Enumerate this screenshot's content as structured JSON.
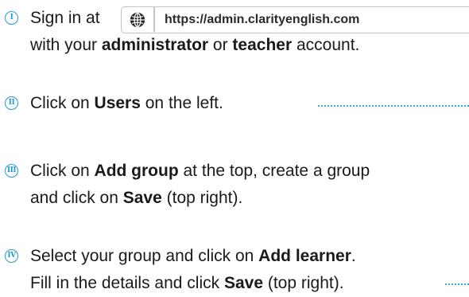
{
  "steps": [
    {
      "numeral": "I",
      "lines": [
        {
          "parts": [
            "Sign in at"
          ]
        },
        {
          "parts": [
            "with your ",
            "administrator",
            " or ",
            "teacher",
            " account."
          ]
        }
      ],
      "url": "https://admin.clarityenglish.com",
      "url_icon": "globe-icon"
    },
    {
      "numeral": "II",
      "lines": [
        {
          "parts": [
            "Click on ",
            "Users",
            " on the left."
          ]
        }
      ]
    },
    {
      "numeral": "III",
      "lines": [
        {
          "parts": [
            "Click on ",
            "Add group",
            " at the top, create a group"
          ]
        },
        {
          "parts": [
            "and click on ",
            "Save",
            " (top right)."
          ]
        }
      ]
    },
    {
      "numeral": "IV",
      "lines": [
        {
          "parts": [
            "Select your group and click on ",
            "Add learner",
            "."
          ]
        },
        {
          "parts": [
            "Fill in the details and click ",
            "Save",
            " (top right)."
          ]
        }
      ]
    }
  ],
  "colors": {
    "accent": "#1f9bd4",
    "text": "#1a1a1a",
    "border": "#c4c4c4"
  }
}
